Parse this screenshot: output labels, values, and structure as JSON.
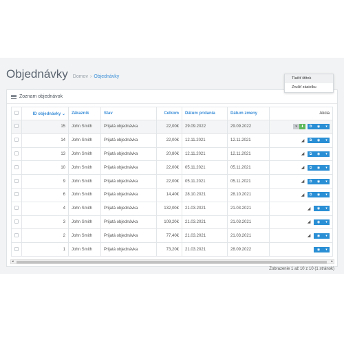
{
  "header": {
    "title": "Objednávky",
    "breadcrumb_home": "Domov",
    "breadcrumb_separator": "›",
    "breadcrumb_current": "Objednávky"
  },
  "panel": {
    "title": "Zoznam objednávok"
  },
  "table": {
    "columns": {
      "id": "ID objednávky",
      "customer": "Zákazník",
      "status": "Stav",
      "total": "Celkom",
      "added": "Dátum pridania",
      "modified": "Dátum zmeny",
      "action": "Akcia"
    },
    "sort_indicator": "⌄",
    "rows": [
      {
        "id": "15",
        "customer": "John Smith",
        "status": "Prijatá objednávka",
        "total": "22,00€",
        "added": "29.09.2022",
        "modified": "29.09.2022"
      },
      {
        "id": "14",
        "customer": "John Smith",
        "status": "Prijatá objednávka",
        "total": "22,00€",
        "added": "12.11.2021",
        "modified": "12.11.2021"
      },
      {
        "id": "13",
        "customer": "John Smith",
        "status": "Prijatá objednávka",
        "total": "20,80€",
        "added": "12.11.2021",
        "modified": "12.11.2021"
      },
      {
        "id": "10",
        "customer": "John Smith",
        "status": "Prijatá objednávka",
        "total": "22,00€",
        "added": "05.11.2021",
        "modified": "05.11.2021"
      },
      {
        "id": "9",
        "customer": "John Smith",
        "status": "Prijatá objednávka",
        "total": "22,00€",
        "added": "05.11.2021",
        "modified": "05.11.2021"
      },
      {
        "id": "6",
        "customer": "John Smith",
        "status": "Prijatá objednávka",
        "total": "14,40€",
        "added": "28.10.2021",
        "modified": "28.10.2021"
      },
      {
        "id": "4",
        "customer": "John Smith",
        "status": "Prijatá objednávka",
        "total": "132,00€",
        "added": "21.03.2021",
        "modified": "21.03.2021"
      },
      {
        "id": "3",
        "customer": "John Smith",
        "status": "Prijatá objednávka",
        "total": "109,20€",
        "added": "21.03.2021",
        "modified": "21.03.2021"
      },
      {
        "id": "2",
        "customer": "John Smith",
        "status": "Prijatá objednávka",
        "total": "77,40€",
        "added": "21.03.2021",
        "modified": "21.03.2021"
      },
      {
        "id": "1",
        "customer": "John Smith",
        "status": "Prijatá objednávka",
        "total": "73,20€",
        "added": "21.03.2021",
        "modified": "28.09.2022"
      }
    ]
  },
  "dropdown": {
    "items": [
      "Tlačiť štítok",
      "Zrušiť zásielku"
    ]
  },
  "footer": {
    "pagination": "Zobrazenie 1 až 10 z 10 (1 stránok)"
  },
  "colors": {
    "accent": "#2a8fd5",
    "link": "#3d8fd8",
    "success": "#5cb85c"
  },
  "icons": {
    "caret": "▾",
    "download": "⬇",
    "external": "⧉",
    "eye": "◉",
    "plane": "◢",
    "scroll_left": "◂",
    "scroll_right": "▸"
  }
}
